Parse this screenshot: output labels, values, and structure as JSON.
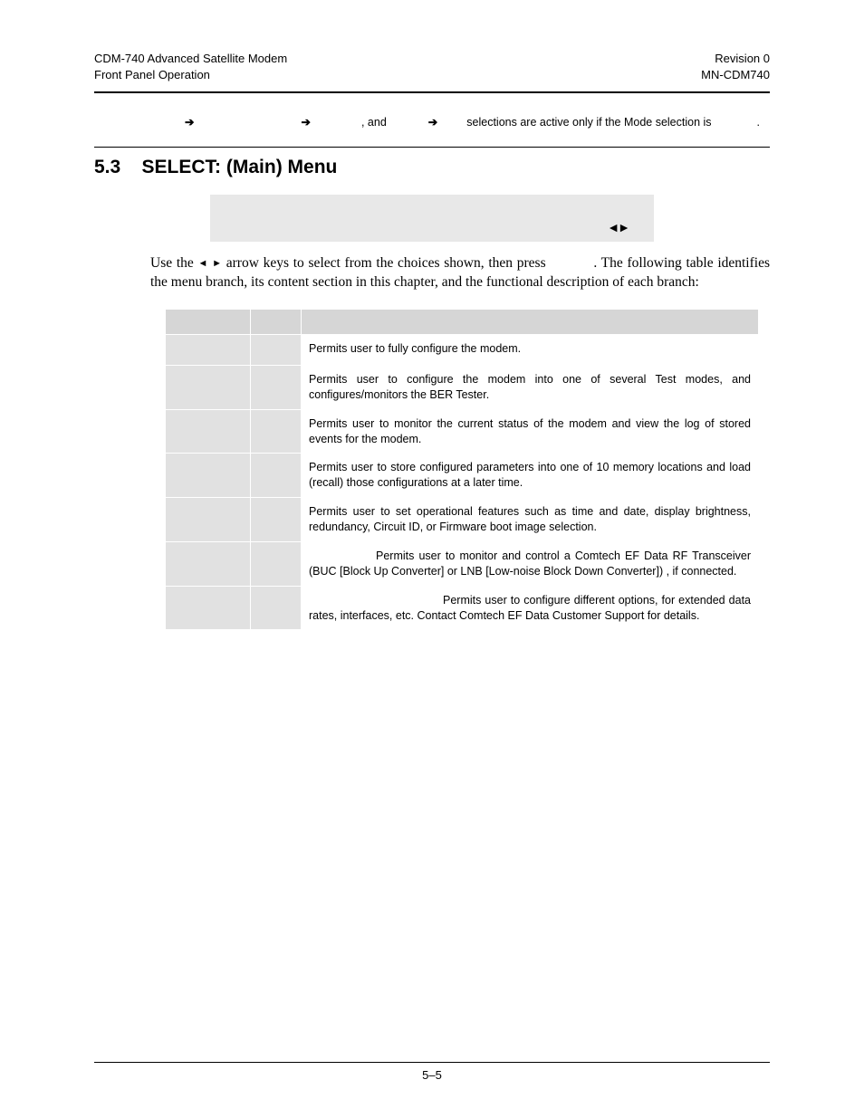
{
  "header": {
    "left1": "CDM-740 Advanced Satellite Modem",
    "left2": "Front Panel Operation",
    "right1": "Revision 0",
    "right2": "MN-CDM740"
  },
  "note": {
    "and": ", and",
    "tail": "selections are active only if the Mode selection is",
    "period": "."
  },
  "section": {
    "num": "5.3",
    "title": "SELECT: (Main) Menu"
  },
  "lcd_arrows": "◄►",
  "body": {
    "p1a": "Use the ",
    "tri_l": "◄",
    "tri_r": "►",
    "p1b": " arrow keys to select from the choices shown, then press ",
    "p1c": ". The following table identifies the menu branch, its content section in this chapter, and the functional description of each branch:"
  },
  "table": {
    "rows": [
      {
        "desc": "Permits user to fully configure the modem."
      },
      {
        "desc": "Permits user to configure the modem into one of several Test modes, and configures/monitors the BER Tester."
      },
      {
        "desc": "Permits user to monitor the current status of the modem and view the log of stored events for the modem."
      },
      {
        "desc": "Permits user to store configured parameters into one of 10 memory locations and load (recall) those configurations at a later time."
      },
      {
        "desc": "Permits user to set operational features such as time and date, display brightness, redundancy, Circuit ID, or Firmware boot image selection."
      },
      {
        "desc_pre": "",
        "desc": "Permits user to monitor and control a Comtech EF Data RF Transceiver (BUC [Block Up Converter] or LNB [Low-noise Block Down Converter]) , if connected."
      },
      {
        "desc_pre": "",
        "desc": "Permits user to configure different options, for extended data rates, interfaces, etc. Contact Comtech EF Data Customer Support for details."
      }
    ]
  },
  "footer": "5–5"
}
